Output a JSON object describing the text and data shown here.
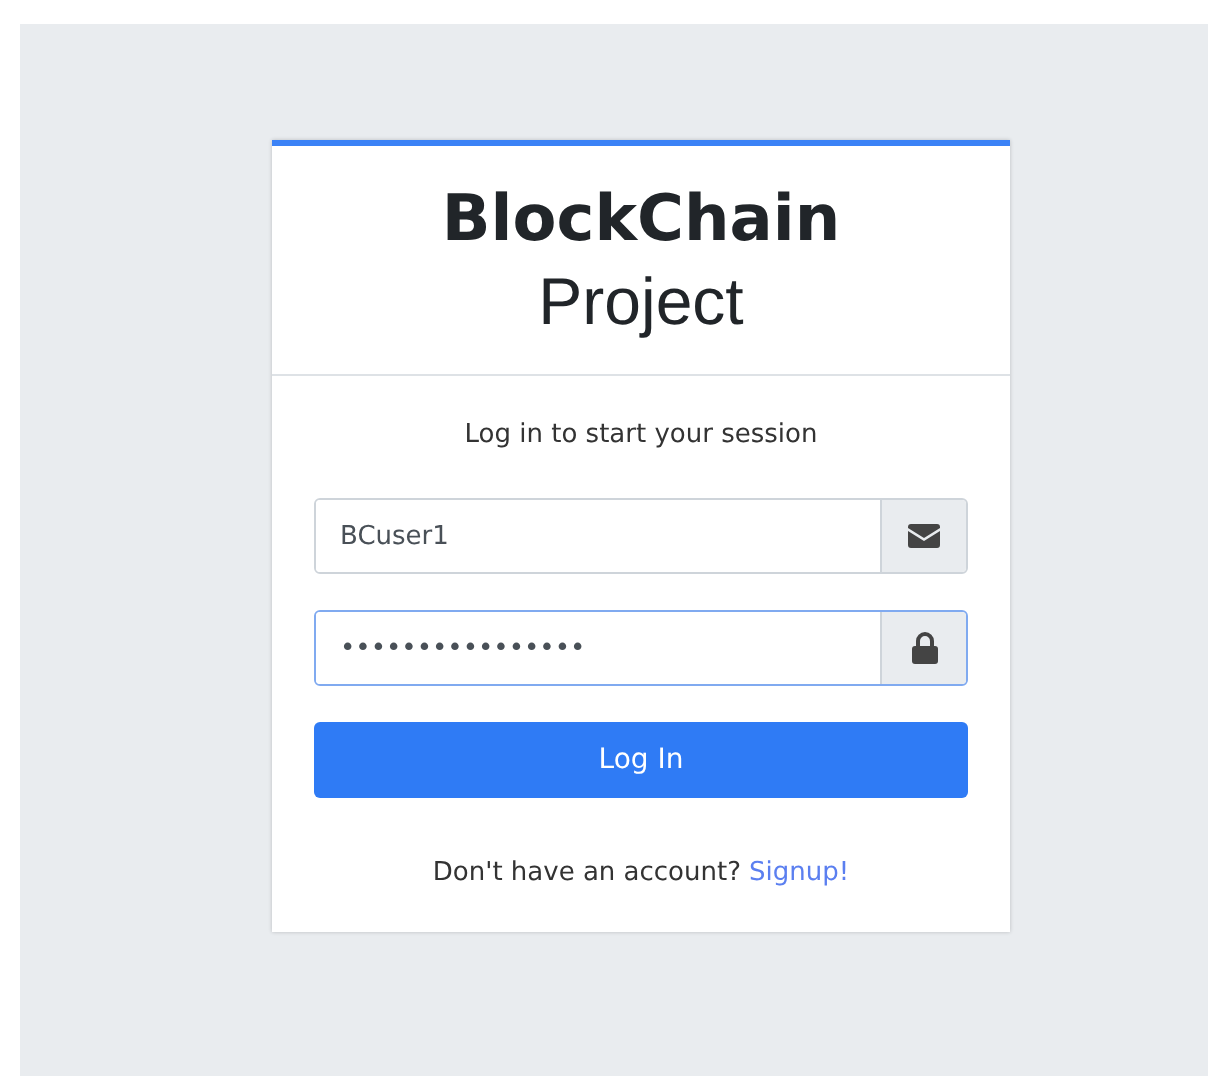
{
  "logo": {
    "bold": "BlockChain",
    "light": "Project"
  },
  "message": "Log in to start your session",
  "fields": [
    {
      "kind": "email",
      "value": "BCuser1",
      "focused": false
    },
    {
      "kind": "password",
      "value": "••••••••••••••••",
      "focused": true
    }
  ],
  "login_button": "Log In",
  "footer": {
    "text": "Don't have an account?",
    "link": "Signup!"
  }
}
